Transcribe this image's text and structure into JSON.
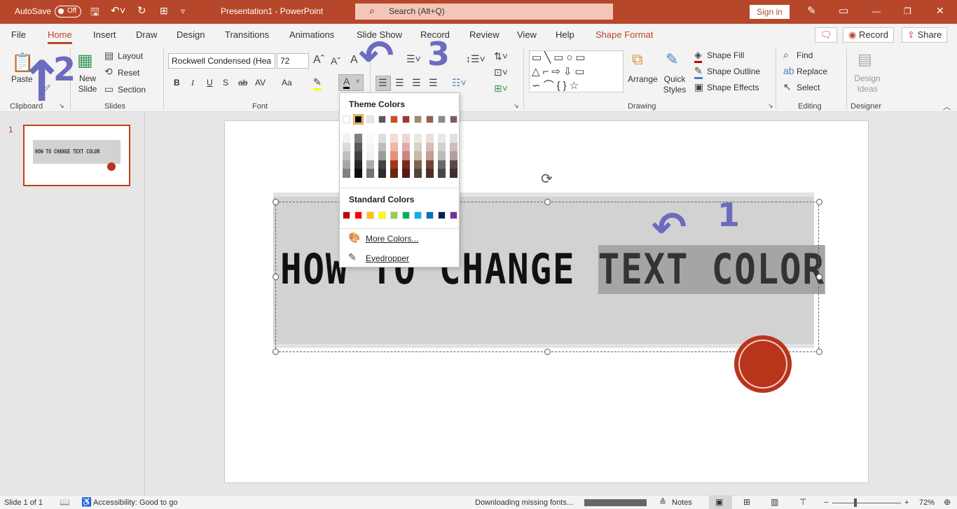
{
  "titlebar": {
    "autosave": "AutoSave",
    "autosave_state": "Off",
    "doc_title": "Presentation1  -  PowerPoint",
    "search_placeholder": "Search (Alt+Q)",
    "sign_in": "Sign in",
    "accent": "#b7472a"
  },
  "tabs": [
    "File",
    "Home",
    "Insert",
    "Draw",
    "Design",
    "Transitions",
    "Animations",
    "Slide Show",
    "Record",
    "Review",
    "View",
    "Help",
    "Shape Format"
  ],
  "tab_actions": {
    "record": "Record",
    "share": "Share"
  },
  "ribbon": {
    "clipboard": {
      "paste": "Paste",
      "group": "Clipboard"
    },
    "slides": {
      "new_slide": "New Slide",
      "layout": "Layout",
      "reset": "Reset",
      "section": "Section",
      "group": "Slides"
    },
    "font": {
      "font_name": "Rockwell Condensed (Hea",
      "font_size": "72",
      "bold": "B",
      "italic": "I",
      "underline": "U",
      "shadow": "S",
      "strike": "ab",
      "spacing": "AV",
      "case": "Aa",
      "group": "Font"
    },
    "drawing": {
      "arrange": "Arrange",
      "quick_styles": "Quick Styles",
      "shape_fill": "Shape Fill",
      "shape_outline": "Shape Outline",
      "shape_effects": "Shape Effects",
      "group": "Drawing"
    },
    "editing": {
      "find": "Find",
      "replace": "Replace",
      "select": "Select",
      "group": "Editing"
    },
    "designer": {
      "design_ideas": "Design Ideas",
      "group": "Designer"
    }
  },
  "color_menu": {
    "theme_header": "Theme Colors",
    "theme_colors": [
      "#ffffff",
      "#000000",
      "#e7e6e6",
      "#595959",
      "#d04a20",
      "#a8322a",
      "#a08b6a",
      "#9c5b49",
      "#8e8a8c",
      "#7f5d5d"
    ],
    "selected_theme_index": 1,
    "standard_header": "Standard Colors",
    "standard_colors": [
      "#c00000",
      "#ff0000",
      "#ffc000",
      "#ffff00",
      "#92d050",
      "#00b050",
      "#00b0f0",
      "#0070c0",
      "#002060",
      "#7030a0"
    ],
    "more_colors": "More Colors...",
    "eyedropper": "Eyedropper"
  },
  "slide_panel": {
    "slide_number": "1",
    "thumb_text": "HOW TO CHANGE TEXT COLOR"
  },
  "slide": {
    "heading_plain": "HOW TO CHANGE ",
    "heading_selected": "TEXT COLOR"
  },
  "annotations": [
    "1",
    "2",
    "3"
  ],
  "status": {
    "slide": "Slide 1 of 1",
    "accessibility": "Accessibility: Good to go",
    "downloading": "Downloading missing fonts...",
    "notes": "Notes",
    "zoom": "72%"
  }
}
